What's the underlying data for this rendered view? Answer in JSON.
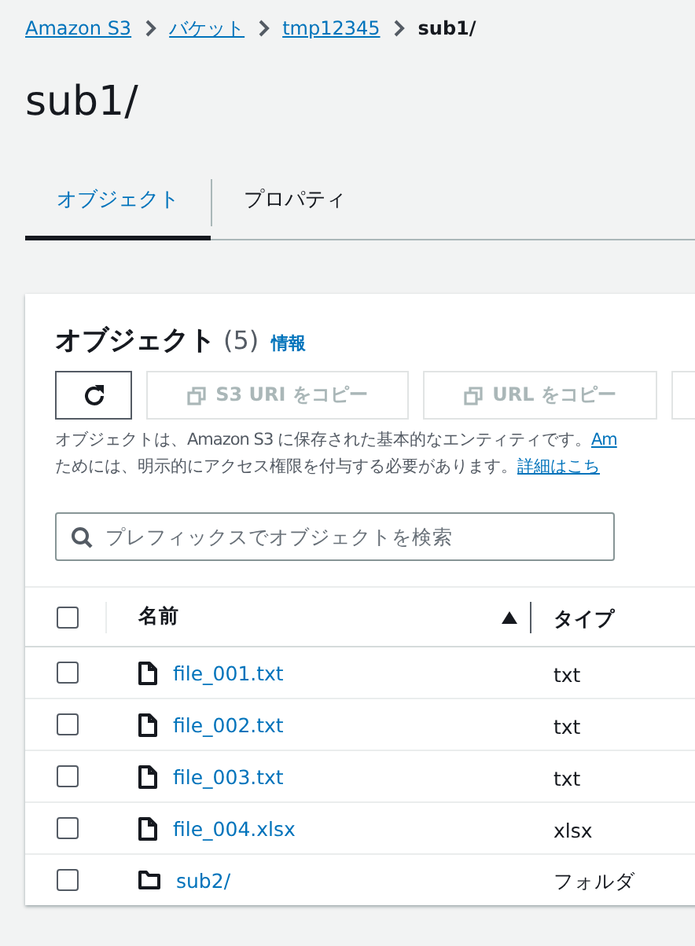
{
  "breadcrumbs": [
    {
      "label": "Amazon S3",
      "current": false
    },
    {
      "label": "バケット",
      "current": false
    },
    {
      "label": "tmp12345",
      "current": false
    },
    {
      "label": "sub1/",
      "current": true
    }
  ],
  "title": "sub1/",
  "tabs": [
    {
      "label": "オブジェクト",
      "selected": true
    },
    {
      "label": "プロパティ",
      "selected": false
    }
  ],
  "objects_panel": {
    "heading": "オブジェクト",
    "count": "(5)",
    "info_link": "情報",
    "buttons": [
      {
        "kind": "refresh",
        "disabled": false
      },
      {
        "kind": "copy",
        "label": "S3 URI をコピー",
        "disabled": true
      },
      {
        "kind": "copy",
        "label": "URL をコピー",
        "disabled": true
      },
      {
        "kind": "blank",
        "disabled": true
      }
    ],
    "description_lines": [
      [
        {
          "text": "オブジェクトは、Amazon S3 に保存された基本的なエンティティです。",
          "link": false
        },
        {
          "text": "Am",
          "link": true
        }
      ],
      [
        {
          "text": "ためには、明示的にアクセス権限を付与する必要があります。",
          "link": false
        },
        {
          "text": "詳細はこち",
          "link": true
        }
      ]
    ],
    "search": {
      "placeholder": "プレフィックスでオブジェクトを検索"
    },
    "table": {
      "select_all_checked": false,
      "columns": [
        {
          "label": "名前",
          "sorted": true
        },
        {
          "label": "タイプ",
          "sorted": false
        }
      ],
      "rows": [
        {
          "kind": "file",
          "name": "file_001.txt",
          "type": "txt",
          "checked": false
        },
        {
          "kind": "file",
          "name": "file_002.txt",
          "type": "txt",
          "checked": false
        },
        {
          "kind": "file",
          "name": "file_003.txt",
          "type": "txt",
          "checked": false
        },
        {
          "kind": "file",
          "name": "file_004.xlsx",
          "type": "xlsx",
          "checked": false
        },
        {
          "kind": "folder",
          "name": "sub2/",
          "type": "フォルダ",
          "checked": false
        }
      ]
    }
  }
}
